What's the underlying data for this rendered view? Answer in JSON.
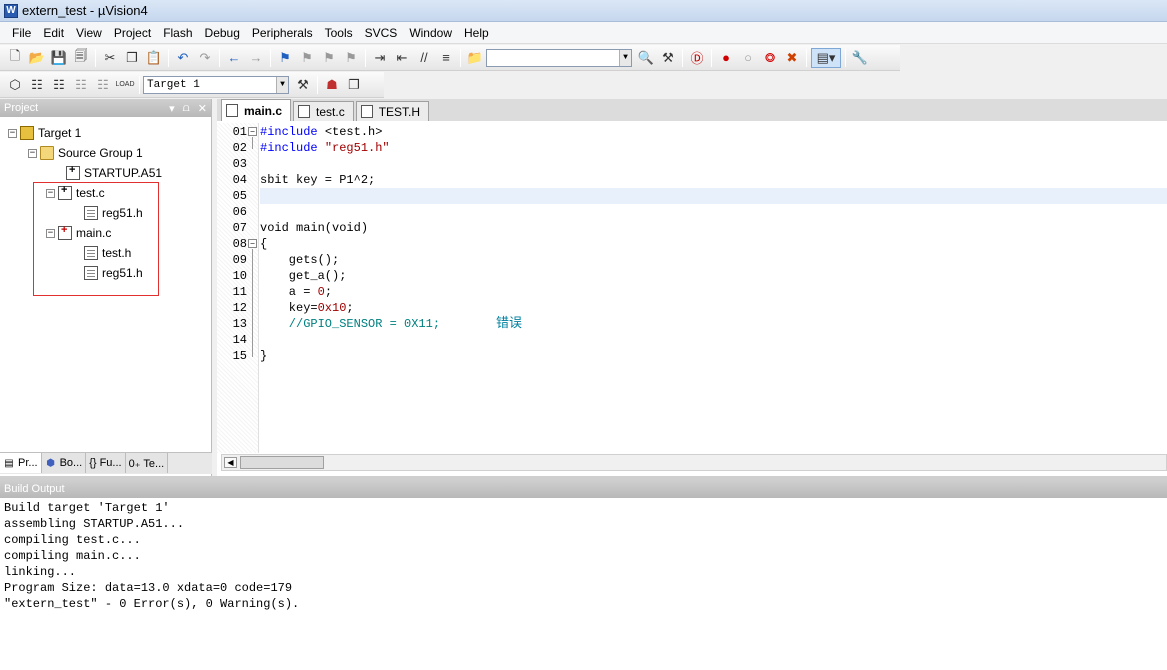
{
  "window": {
    "title": "extern_test  - µVision4"
  },
  "menu": [
    "File",
    "Edit",
    "View",
    "Project",
    "Flash",
    "Debug",
    "Peripherals",
    "Tools",
    "SVCS",
    "Window",
    "Help"
  ],
  "toolbar2": {
    "target_select": "Target 1"
  },
  "project_panel": {
    "title": "Project",
    "tree": {
      "target": "Target 1",
      "group": "Source Group 1",
      "startup": "STARTUP.A51",
      "test_c": "test.c",
      "test_c_child": "reg51.h",
      "main_c": "main.c",
      "main_c_child1": "test.h",
      "main_c_child2": "reg51.h"
    },
    "tabs": [
      "Pr...",
      "Bo...",
      "{} Fu...",
      "0₊ Te..."
    ]
  },
  "editor": {
    "tabs": [
      "main.c",
      "test.c",
      "TEST.H"
    ],
    "active_tab": "main.c",
    "line_numbers": [
      "01",
      "02",
      "03",
      "04",
      "05",
      "06",
      "07",
      "08",
      "09",
      "10",
      "11",
      "12",
      "13",
      "14",
      "15"
    ],
    "current_line": 5
  },
  "build_output": {
    "title": "Build Output",
    "lines": [
      "Build target 'Target 1'",
      "assembling STARTUP.A51...",
      "compiling test.c...",
      "compiling main.c...",
      "linking...",
      "Program Size: data=13.0 xdata=0 code=179",
      "\"extern_test\" - 0 Error(s), 0 Warning(s)."
    ]
  },
  "code": {
    "l1_pre": "#include ",
    "l1_inc": "<test.h>",
    "l2_pre": "#include ",
    "l2_inc": "\"reg51.h\"",
    "l4": "sbit key = P1^2;",
    "l7": "void main(void)",
    "l8": "{",
    "l9": "    gets();",
    "l10": "    get_a();",
    "l11_a": "    a = ",
    "l11_num": "0",
    "l11_b": ";",
    "l12_a": "    key=",
    "l12_num": "0x10",
    "l12_b": ";",
    "l13_cmt": "    //GPIO_SENSOR = 0X11;",
    "l13_note": "错误",
    "l15": "}"
  },
  "colors": {
    "keyword": "#0000ff",
    "string": "#a00000",
    "comment": "#008080",
    "annotation_box": "#e03030"
  }
}
